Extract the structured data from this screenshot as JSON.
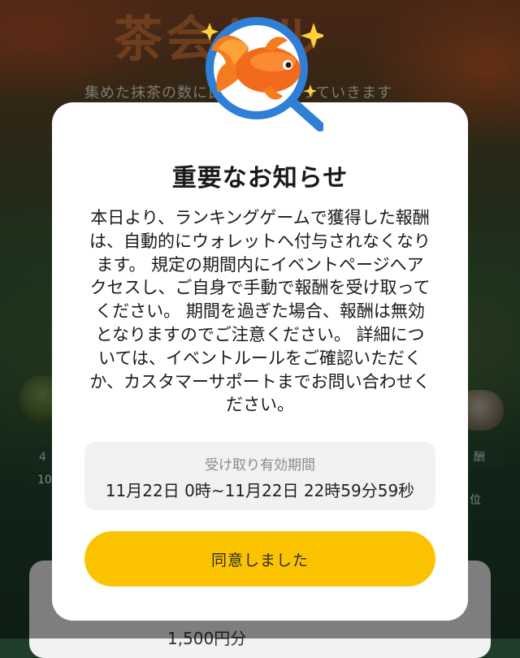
{
  "background": {
    "title": "茶会ドル",
    "subtitle": "集めた抹茶の数に比　　　上がっていきます",
    "left_pill": "4",
    "left_caption": "10",
    "right_pill": "酬",
    "right_caption": "位",
    "bottom_amount": "1,500円分"
  },
  "modal": {
    "badge_icon": "goldfish-magnifier-icon",
    "title": "重要なお知らせ",
    "body_lines": [
      "本日より、ランキングゲームで獲得した報酬",
      "は、自動的にウォレットへ付与されなくなり",
      "ます。 規定の期間内にイベントページへア",
      "クセスし、ご自身で手動で報酬を受け取って",
      "ください。 期間を過ぎた場合、報酬は無効",
      "となりますのでご注意ください。 詳細につ",
      "いては、イベントルールをご確認いただく",
      "か、カスタマーサポートまでお問い合わせく",
      "ださい。"
    ],
    "period_label": "受け取り有効期間",
    "period_value": "11月22日 0時~11月22日 22時59分59秒",
    "agree_button": "同意しました"
  },
  "colors": {
    "accent_button": "#fcc400",
    "modal_bg": "#ffffff",
    "period_box_bg": "#f1f1f1",
    "magnifier_blue": "#2f7fd6",
    "goldfish_orange": "#f26a1b"
  }
}
